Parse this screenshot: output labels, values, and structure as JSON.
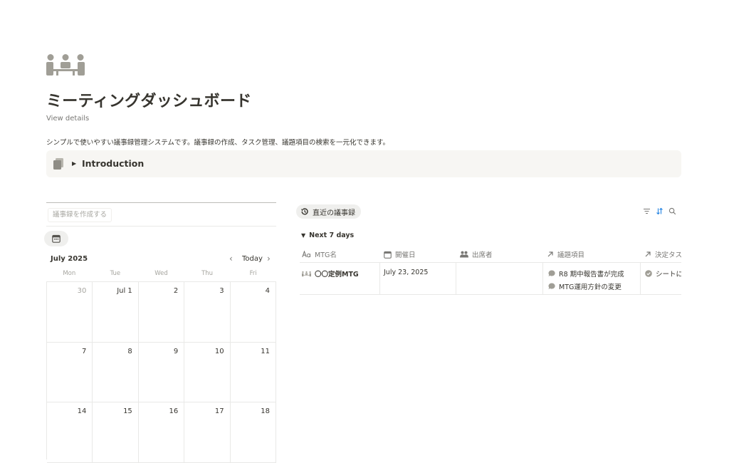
{
  "page": {
    "title": "ミーティングダッシュボード",
    "view_details": "View details",
    "description": "シンプルで使いやすい議事録管理システムです。議事録の作成、タスク管理、議題項目の検索を一元化できます。",
    "icon": "meeting-people-icon"
  },
  "callout": {
    "title": "Introduction",
    "icon": "pages-icon"
  },
  "calendar": {
    "create_button": "議事録を作成する",
    "month": "July 2025",
    "today": "Today",
    "weekdays": [
      "Mon",
      "Tue",
      "Wed",
      "Thu",
      "Fri"
    ],
    "weeks": [
      [
        "30",
        "Jul 1",
        "2",
        "3",
        "4"
      ],
      [
        "7",
        "8",
        "9",
        "10",
        "11"
      ],
      [
        "14",
        "15",
        "16",
        "17",
        "18"
      ]
    ]
  },
  "database": {
    "view_tab": "直近の議事録",
    "group": "Next 7 days",
    "columns": [
      {
        "label": "MTG名",
        "icon": "text-type-icon"
      },
      {
        "label": "開催日",
        "icon": "calendar-icon"
      },
      {
        "label": "出席者",
        "icon": "people-icon"
      },
      {
        "label": "議題項目",
        "icon": "relation-arrow-icon"
      },
      {
        "label": "決定タスク",
        "icon": "relation-arrow-icon"
      }
    ],
    "rows": [
      {
        "name": "〇〇定例MTG",
        "date": "July 23, 2025",
        "attendees": "",
        "agenda": [
          "R8 期中報告書が完成",
          "MTG運用方針の変更"
        ],
        "tasks": [
          "シートに"
        ]
      }
    ]
  },
  "colors": {
    "accent_blue": "#2383e2",
    "icon_gray": "#a09e96",
    "text": "#37352f",
    "muted": "#787774"
  }
}
